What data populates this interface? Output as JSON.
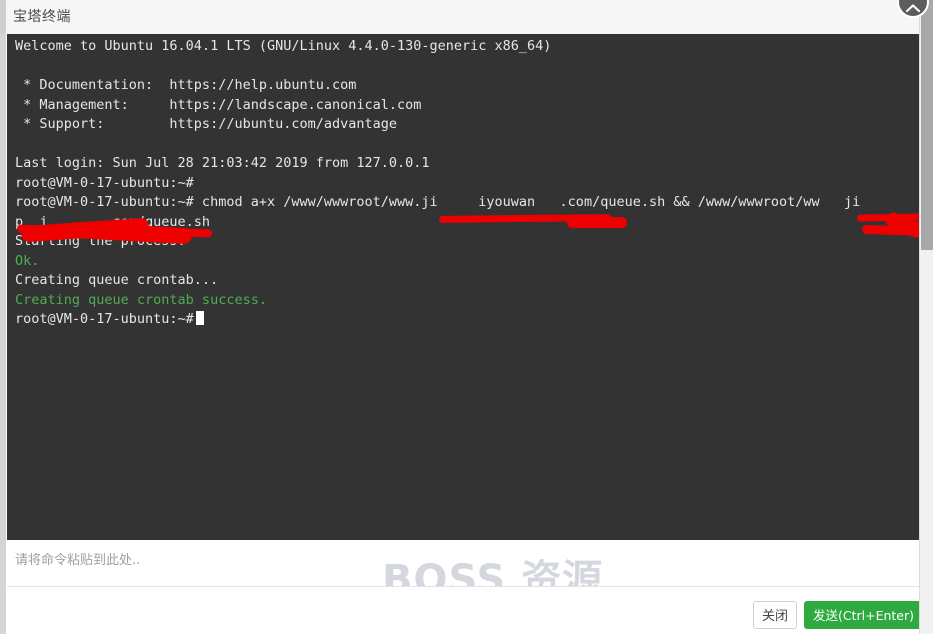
{
  "window": {
    "title": "宝塔终端",
    "round_button_icon": "chevron-up-icon"
  },
  "terminal": {
    "lines": [
      {
        "text": "Welcome to Ubuntu 16.04.1 LTS (GNU/Linux 4.4.0-130-generic x86_64)",
        "color": "white"
      },
      {
        "text": "",
        "color": "white"
      },
      {
        "text": " * Documentation:  https://help.ubuntu.com",
        "color": "white"
      },
      {
        "text": " * Management:     https://landscape.canonical.com",
        "color": "white"
      },
      {
        "text": " * Support:        https://ubuntu.com/advantage",
        "color": "white"
      },
      {
        "text": "",
        "color": "white"
      },
      {
        "text": "Last login: Sun Jul 28 21:03:42 2019 from 127.0.0.1",
        "color": "white"
      },
      {
        "text": "root@VM-0-17-ubuntu:~#",
        "color": "white"
      },
      {
        "text": "root@VM-0-17-ubuntu:~# chmod a+x /www/wwwroot/www.ji     iyouwan   .com/queue.sh && /www/wwwroot/ww   ji   ",
        "color": "white"
      },
      {
        "text": "p  j       .com/queue.sh",
        "color": "white"
      },
      {
        "text": "Starting the process.",
        "color": "white"
      },
      {
        "text": "Ok.",
        "color": "green"
      },
      {
        "text": "Creating queue crontab...",
        "color": "white"
      },
      {
        "text": "Creating queue crontab success.",
        "color": "green"
      },
      {
        "text": "root@VM-0-17-ubuntu:~#",
        "color": "white",
        "cursor": true
      }
    ],
    "background_color": "#333333",
    "text_color": "#e6e6e6",
    "green_color": "#4fad4f"
  },
  "command_input": {
    "value": "",
    "placeholder": "请将命令粘贴到此处.."
  },
  "watermark": {
    "text": "BOSS 资源"
  },
  "footer": {
    "close_label": "关闭",
    "send_label": "发送(Ctrl+Enter)",
    "send_color": "#2eaa41"
  }
}
